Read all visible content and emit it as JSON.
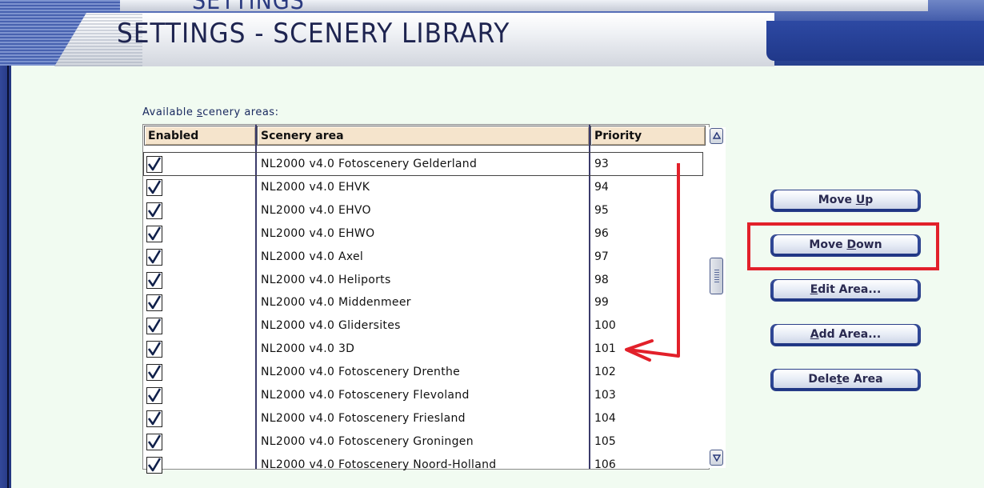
{
  "header": {
    "ghost_title": "SETTINGS",
    "title": "SETTINGS - SCENERY LIBRARY"
  },
  "list": {
    "label_pre": "Available ",
    "label_accel": "s",
    "label_post": "cenery areas:",
    "columns": {
      "enabled": "Enabled",
      "area": "Scenery area",
      "priority": "Priority"
    },
    "rows": [
      {
        "enabled": true,
        "name": "NL2000 v4.0 Fotoscenery Gelderland",
        "priority": "93",
        "selected": true
      },
      {
        "enabled": true,
        "name": "NL2000 v4.0 EHVK",
        "priority": "94"
      },
      {
        "enabled": true,
        "name": "NL2000 v4.0 EHVO",
        "priority": "95"
      },
      {
        "enabled": true,
        "name": "NL2000 v4.0 EHWO",
        "priority": "96"
      },
      {
        "enabled": true,
        "name": "NL2000 v4.0 Axel",
        "priority": "97"
      },
      {
        "enabled": true,
        "name": "NL2000 v4.0 Heliports",
        "priority": "98"
      },
      {
        "enabled": true,
        "name": "NL2000 v4.0 Middenmeer",
        "priority": "99"
      },
      {
        "enabled": true,
        "name": "NL2000 v4.0 Glidersites",
        "priority": "100"
      },
      {
        "enabled": true,
        "name": "NL2000 v4.0 3D",
        "priority": "101"
      },
      {
        "enabled": true,
        "name": "NL2000 v4.0 Fotoscenery Drenthe",
        "priority": "102"
      },
      {
        "enabled": true,
        "name": "NL2000 v4.0 Fotoscenery Flevoland",
        "priority": "103"
      },
      {
        "enabled": true,
        "name": "NL2000 v4.0 Fotoscenery Friesland",
        "priority": "104"
      },
      {
        "enabled": true,
        "name": "NL2000 v4.0 Fotoscenery Groningen",
        "priority": "105"
      },
      {
        "enabled": true,
        "name": "NL2000 v4.0 Fotoscenery Noord-Holland",
        "priority": "106"
      }
    ]
  },
  "buttons": {
    "move_up": {
      "pre": "Move ",
      "accel": "U",
      "post": "p"
    },
    "move_down": {
      "pre": "Move ",
      "accel": "D",
      "post": "own"
    },
    "edit_area": {
      "pre": "",
      "accel": "E",
      "post": "dit Area..."
    },
    "add_area": {
      "pre": "",
      "accel": "A",
      "post": "dd Area..."
    },
    "delete_area": {
      "pre": "Dele",
      "accel": "t",
      "post": "e Area"
    }
  },
  "colors": {
    "annotation": "#e2202a",
    "header_fill": "#f5e4cc",
    "frame_blue": "#27408e",
    "background": "#f1fbf1"
  },
  "icons": {
    "checkbox": "check-icon",
    "scroll_up": "arrow-up-icon",
    "scroll_down": "arrow-down-icon"
  }
}
